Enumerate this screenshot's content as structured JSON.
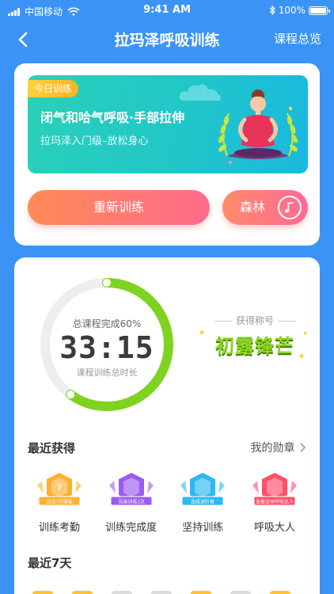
{
  "status_bar": {
    "carrier": "中国移动",
    "time": "9:41 AM",
    "battery": "100%"
  },
  "nav": {
    "title": "拉玛泽呼吸训练",
    "right_link": "课程总览"
  },
  "today": {
    "tag": "今日训练",
    "title": "闭气和哈气呼吸·手部拉伸",
    "subtitle": "拉玛泽入门级–放松身心"
  },
  "buttons": {
    "restart": "重新训练",
    "music": "森林"
  },
  "progress": {
    "completion_label": "总课程完成60%",
    "completion_fraction": 0.6,
    "total_time": "33:15",
    "time_label": "课程训练总时长"
  },
  "honor": {
    "caption": "获得称号",
    "title": "初露锋芒"
  },
  "recent": {
    "title": "最近获得",
    "my_badges": "我的勋章",
    "badges": [
      {
        "label": "训练考勤",
        "ribbon": "完成7天课程",
        "number": "7",
        "color": "#ffb02e"
      },
      {
        "label": "训练完成度",
        "ribbon": "完美训练1次",
        "number": "",
        "color": "#9b5cf0"
      },
      {
        "label": "坚持训练",
        "ribbon": "连续进阶者",
        "number": "",
        "color": "#2cb8f0"
      },
      {
        "label": "呼吸大人",
        "ribbon": "连看坚持呼吸达人",
        "number": "",
        "color": "#ff4d6a"
      }
    ]
  },
  "last7": {
    "title": "最近7天"
  },
  "colors": {
    "primary": "#3b93f6",
    "ring_green": "#7ed321",
    "button_start": "#ff8a57",
    "button_end": "#ff6b8c"
  },
  "icons": [
    "back-chevron-icon",
    "wifi-icon",
    "bluetooth-icon",
    "music-note-icon",
    "chevron-right-icon"
  ]
}
